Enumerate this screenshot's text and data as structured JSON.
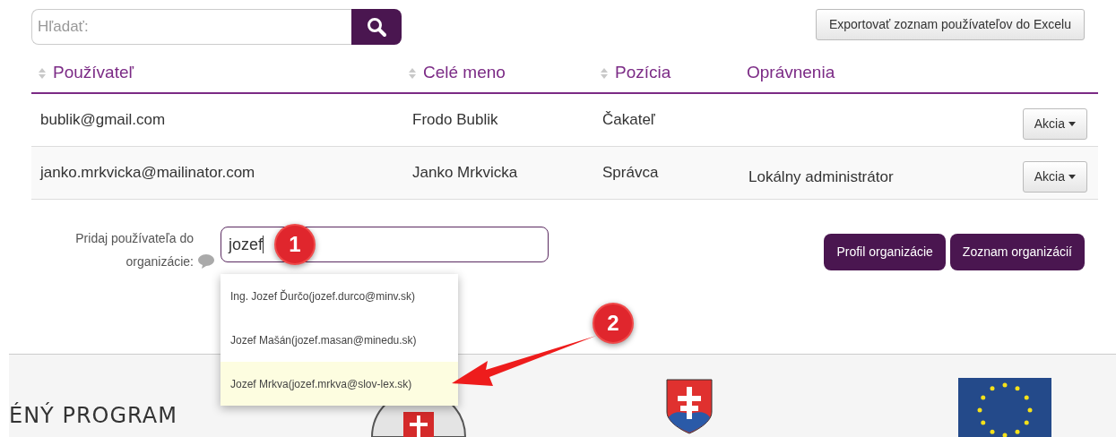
{
  "search": {
    "placeholder": "Hľadať:"
  },
  "export_button": "Exportovať zoznam používateľov do Excelu",
  "table": {
    "columns": [
      {
        "label": "Používateľ",
        "sortable": true
      },
      {
        "label": "Celé meno",
        "sortable": true
      },
      {
        "label": "Pozícia",
        "sortable": true
      },
      {
        "label": "Oprávnenia",
        "sortable": false
      }
    ],
    "rows": [
      {
        "cells": [
          "bublik@gmail.com",
          "Frodo Bublik",
          "Čakateľ",
          ""
        ],
        "action": "Akcia"
      },
      {
        "cells": [
          "janko.mrkvicka@mailinator.com",
          "Janko Mrkvicka",
          "Správca",
          "Lokálny administrátor"
        ],
        "action": "Akcia"
      }
    ]
  },
  "add_user": {
    "label": "Pridaj používateľa do organizácie:",
    "value": "jozef",
    "suggestions": [
      {
        "label": "Ing. Jozef Ďurčo(jozef.durco@minv.sk)",
        "selected": false
      },
      {
        "label": "Jozef Mašán(jozef.masan@minedu.sk)",
        "selected": false
      },
      {
        "label": "Jozef Mrkva(jozef.mrkva@slov-lex.sk)",
        "selected": true
      }
    ]
  },
  "buttons": [
    "Profil organizácie",
    "Zoznam organizácií"
  ],
  "footer": {
    "text": "ÉNÝ PROGRAM"
  },
  "annotations": [
    {
      "label": "1"
    },
    {
      "label": "2"
    }
  ]
}
